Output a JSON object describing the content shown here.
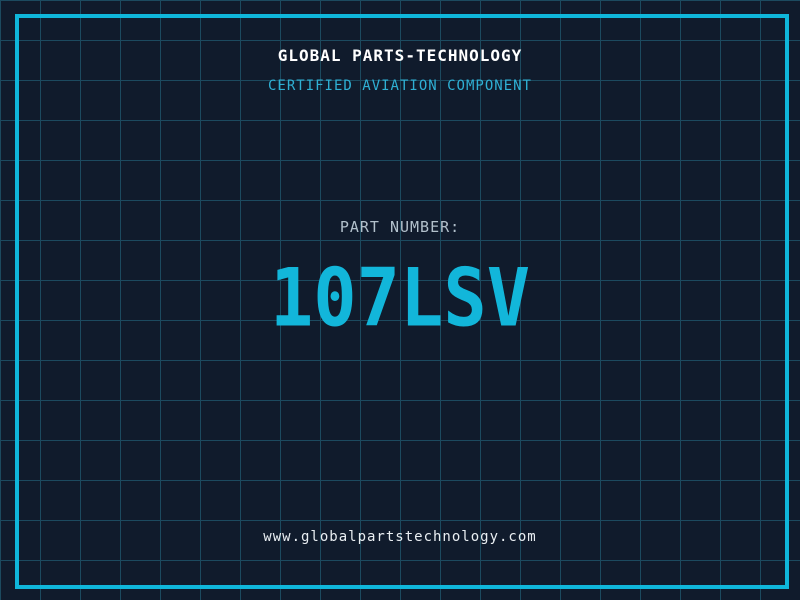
{
  "card": {
    "title": "GLOBAL PARTS-TECHNOLOGY",
    "subtitle": "CERTIFIED AVIATION COMPONENT",
    "part_label": "PART NUMBER:",
    "part_number": "107LSV",
    "website": "www.globalpartstechnology.com"
  },
  "colors": {
    "background": "#101b2c",
    "grid_line": "#1c4a5f",
    "frame_accent": "#0fb6da",
    "title_text": "#ffffff",
    "subtitle_text": "#2fb0d4",
    "part_label_text": "#b2c0cb",
    "part_number_text": "#12b6da",
    "website_text": "#e9eef2"
  }
}
